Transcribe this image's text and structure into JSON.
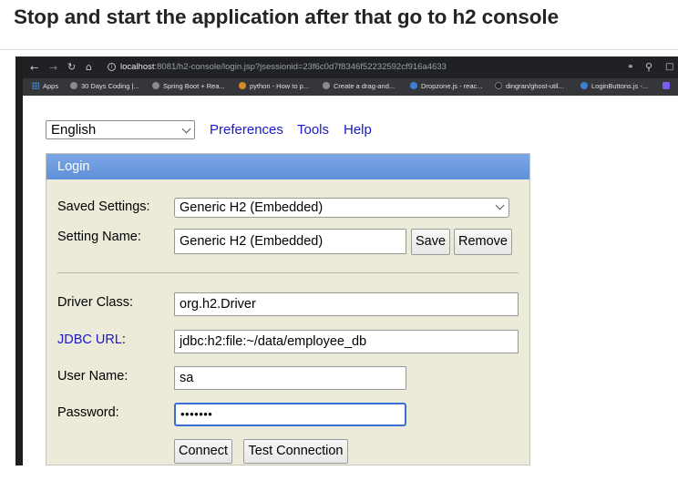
{
  "page_heading": "Stop and start the application after that go to h2 console",
  "browser": {
    "url_host": "localhost",
    "url_rest": ":8081/h2-console/login.jsp?jsessionid=23f6c0d7f8346f52232592cf916a4633",
    "nav_icons": [
      "back-icon",
      "forward-icon",
      "reload-icon",
      "home-icon"
    ],
    "bookmarks": [
      "Apps",
      "30 Days Coding |...",
      "Spring Boot + Rea...",
      "python - How to p...",
      "Create a drag-and...",
      "Dropzone.js - reac...",
      "dingran/ghost-util...",
      "LoginButtons.js -..."
    ]
  },
  "h2": {
    "language": "English",
    "links": [
      "Preferences",
      "Tools",
      "Help"
    ],
    "login_title": "Login",
    "saved_settings_label": "Saved Settings:",
    "saved_settings_value": "Generic H2 (Embedded)",
    "setting_name_label": "Setting Name:",
    "setting_name_value": "Generic H2 (Embedded)",
    "save_button": "Save",
    "remove_button": "Remove",
    "driver_class_label": "Driver Class:",
    "driver_class_value": "org.h2.Driver",
    "jdbc_url_label": "JDBC URL",
    "jdbc_url_colon": ":",
    "jdbc_url_value": "jdbc:h2:file:~/data/employee_db",
    "user_name_label": "User Name:",
    "user_name_value": "sa",
    "password_label": "Password:",
    "password_value": "•••••••",
    "connect_button": "Connect",
    "test_connection_button": "Test Connection"
  },
  "colors": {
    "link": "#1a18c8",
    "panel_bg": "#ecebda",
    "header_blue": "#6b9ade"
  }
}
